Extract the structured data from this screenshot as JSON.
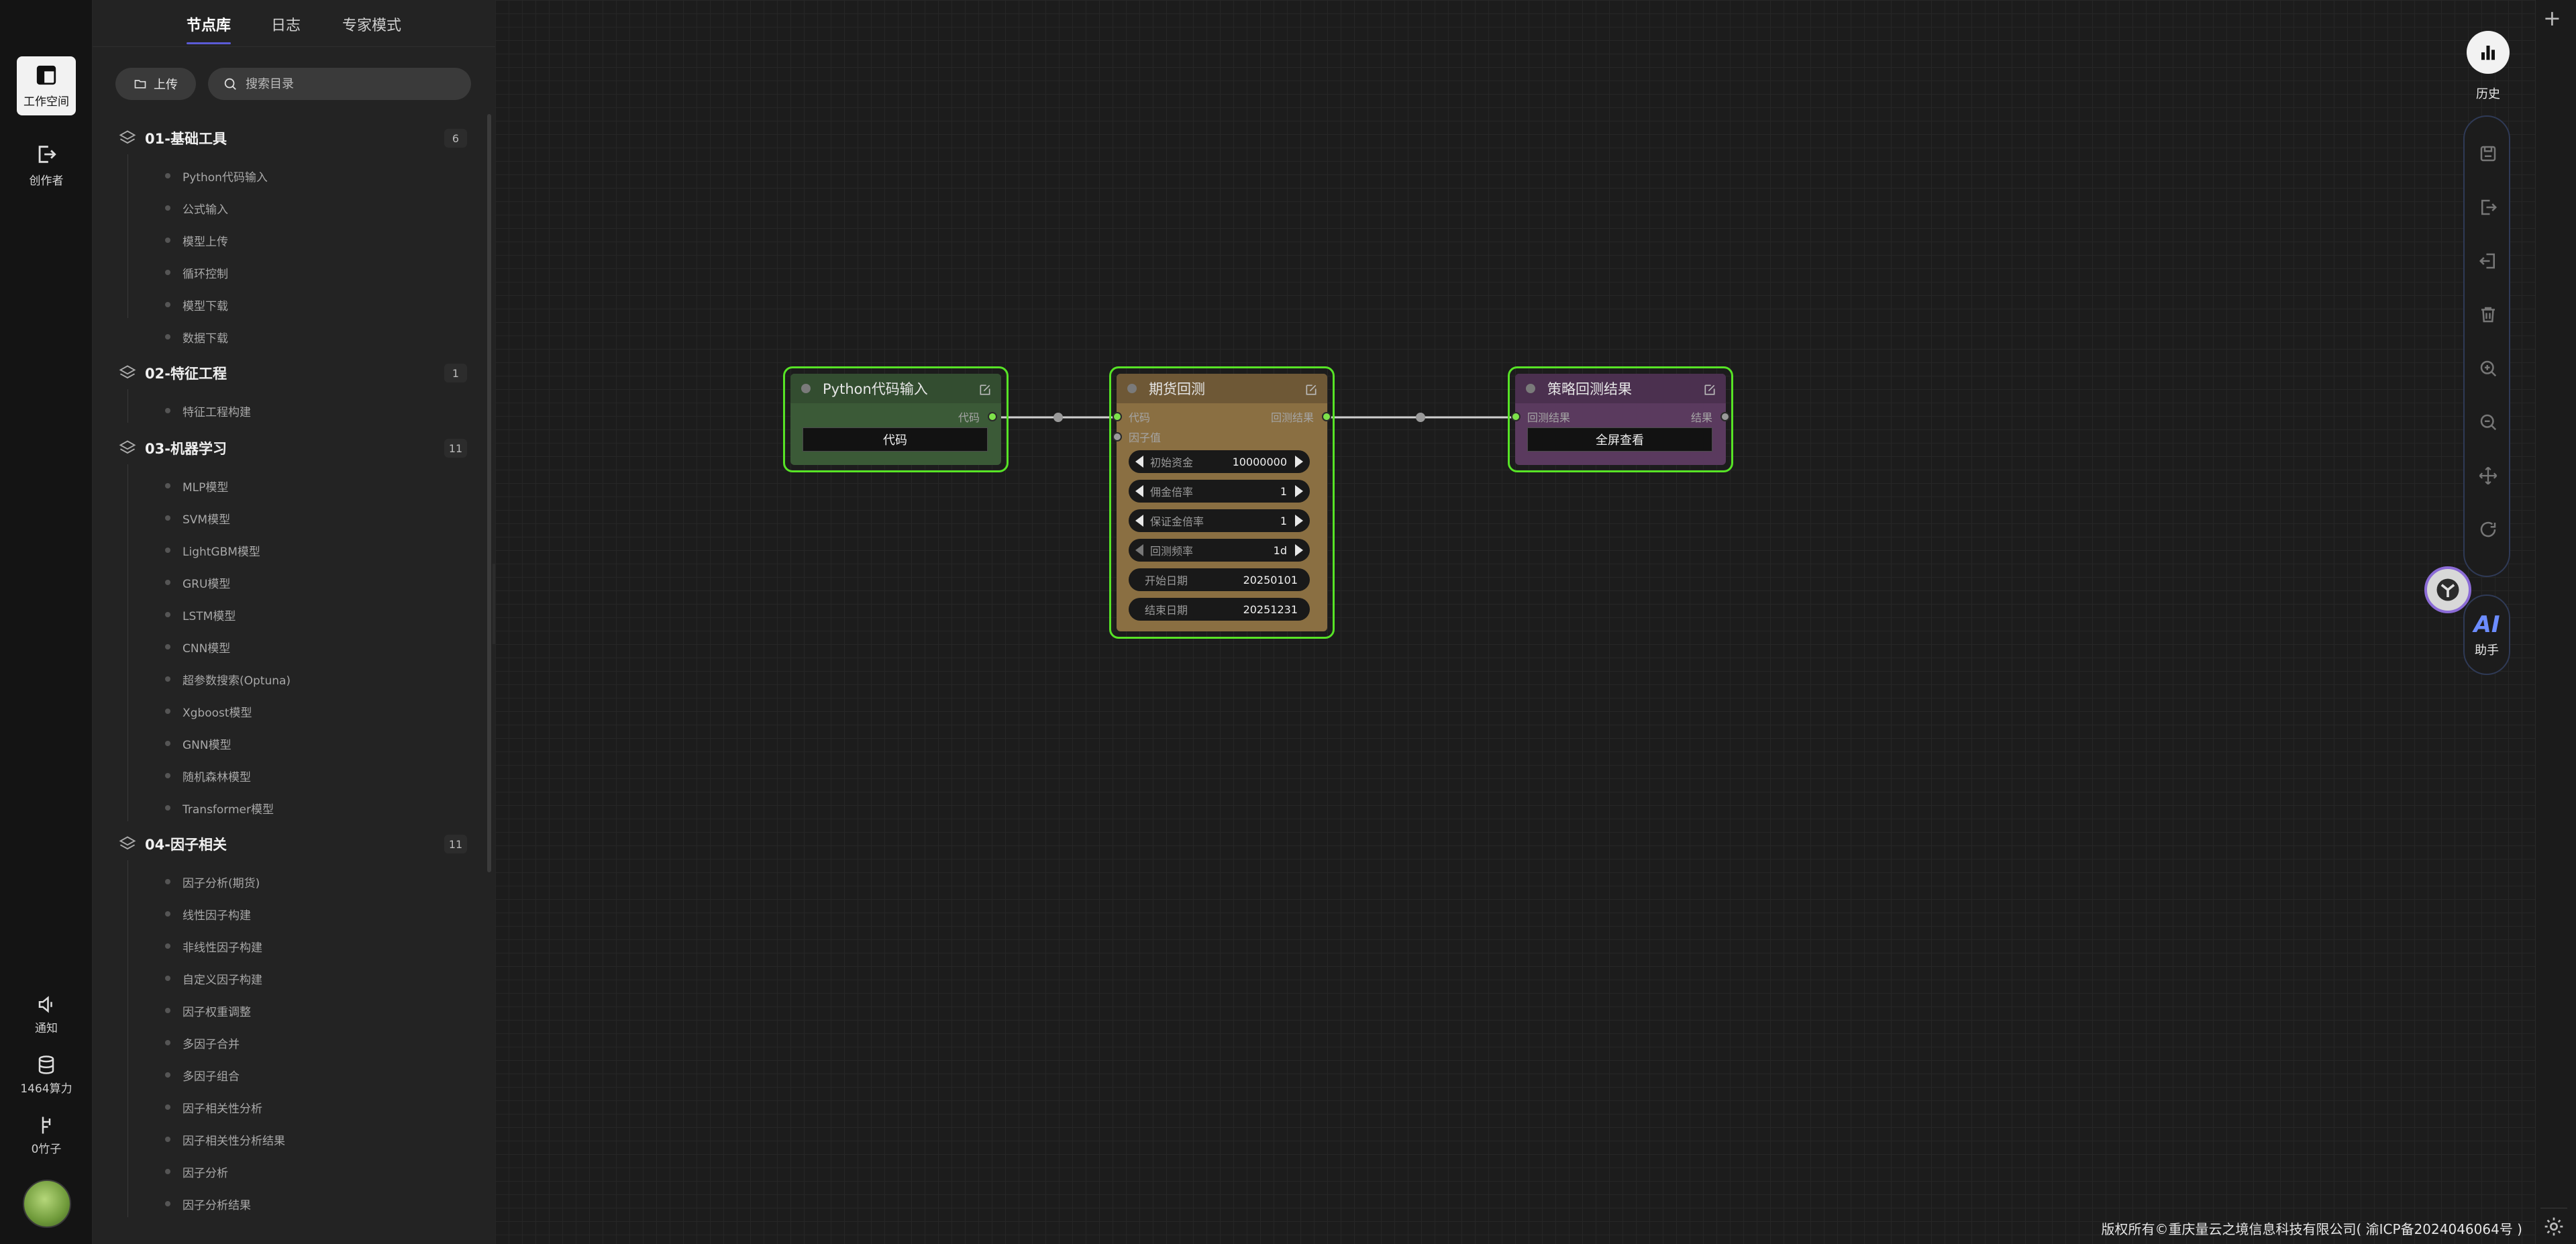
{
  "rail": {
    "workspace": "工作空间",
    "creator": "创作者",
    "notice": "通知",
    "compute": "1464算力",
    "bamboo": "0竹子"
  },
  "panel": {
    "tabs": [
      "节点库",
      "日志",
      "专家模式"
    ],
    "upload_label": "上传",
    "search_placeholder": "搜索目录",
    "groups": [
      {
        "title": "01-基础工具",
        "count": "6",
        "items": [
          "Python代码输入",
          "公式输入",
          "模型上传",
          "循环控制",
          "模型下载",
          "数据下载"
        ]
      },
      {
        "title": "02-特征工程",
        "count": "1",
        "items": [
          "特征工程构建"
        ]
      },
      {
        "title": "03-机器学习",
        "count": "11",
        "items": [
          "MLP模型",
          "SVM模型",
          "LightGBM模型",
          "GRU模型",
          "LSTM模型",
          "CNN模型",
          "超参数搜索(Optuna)",
          "Xgboost模型",
          "GNN模型",
          "随机森林模型",
          "Transformer模型"
        ]
      },
      {
        "title": "04-因子相关",
        "count": "11",
        "items": [
          "因子分析(期货)",
          "线性因子构建",
          "非线性因子构建",
          "自定义因子构建",
          "因子权重调整",
          "多因子合并",
          "多因子组合",
          "因子相关性分析",
          "因子相关性分析结果",
          "因子分析",
          "因子分析结果"
        ]
      }
    ]
  },
  "nodes": {
    "python": {
      "title": "Python代码输入",
      "out_port": "代码",
      "button": "代码"
    },
    "futures": {
      "title": "期货回测",
      "in_port_1": "代码",
      "in_port_2": "因子值",
      "out_port": "回测结果",
      "params": [
        {
          "label": "初始资金",
          "value": "10000000"
        },
        {
          "label": "佣金倍率",
          "value": "1"
        },
        {
          "label": "保证金倍率",
          "value": "1"
        },
        {
          "label": "回测频率",
          "value": "1d"
        }
      ],
      "dates": [
        {
          "label": "开始日期",
          "value": "20250101"
        },
        {
          "label": "结束日期",
          "value": "20251231"
        }
      ]
    },
    "result": {
      "title": "策略回测结果",
      "in_port": "回测结果",
      "out_port": "结果",
      "button": "全屏查看"
    }
  },
  "toolbar": {
    "history": "历史",
    "ai_glyph": "AI",
    "ai_label": "助手"
  },
  "footer": {
    "copyright": "版权所有©重庆量云之境信息科技有限公司( 渝ICP备2024046064号 )"
  },
  "colors": {
    "accent": "#57e326",
    "python_node": "#3b5a37",
    "futures_node": "#8a6f42",
    "result_node": "#5a3a5e"
  }
}
